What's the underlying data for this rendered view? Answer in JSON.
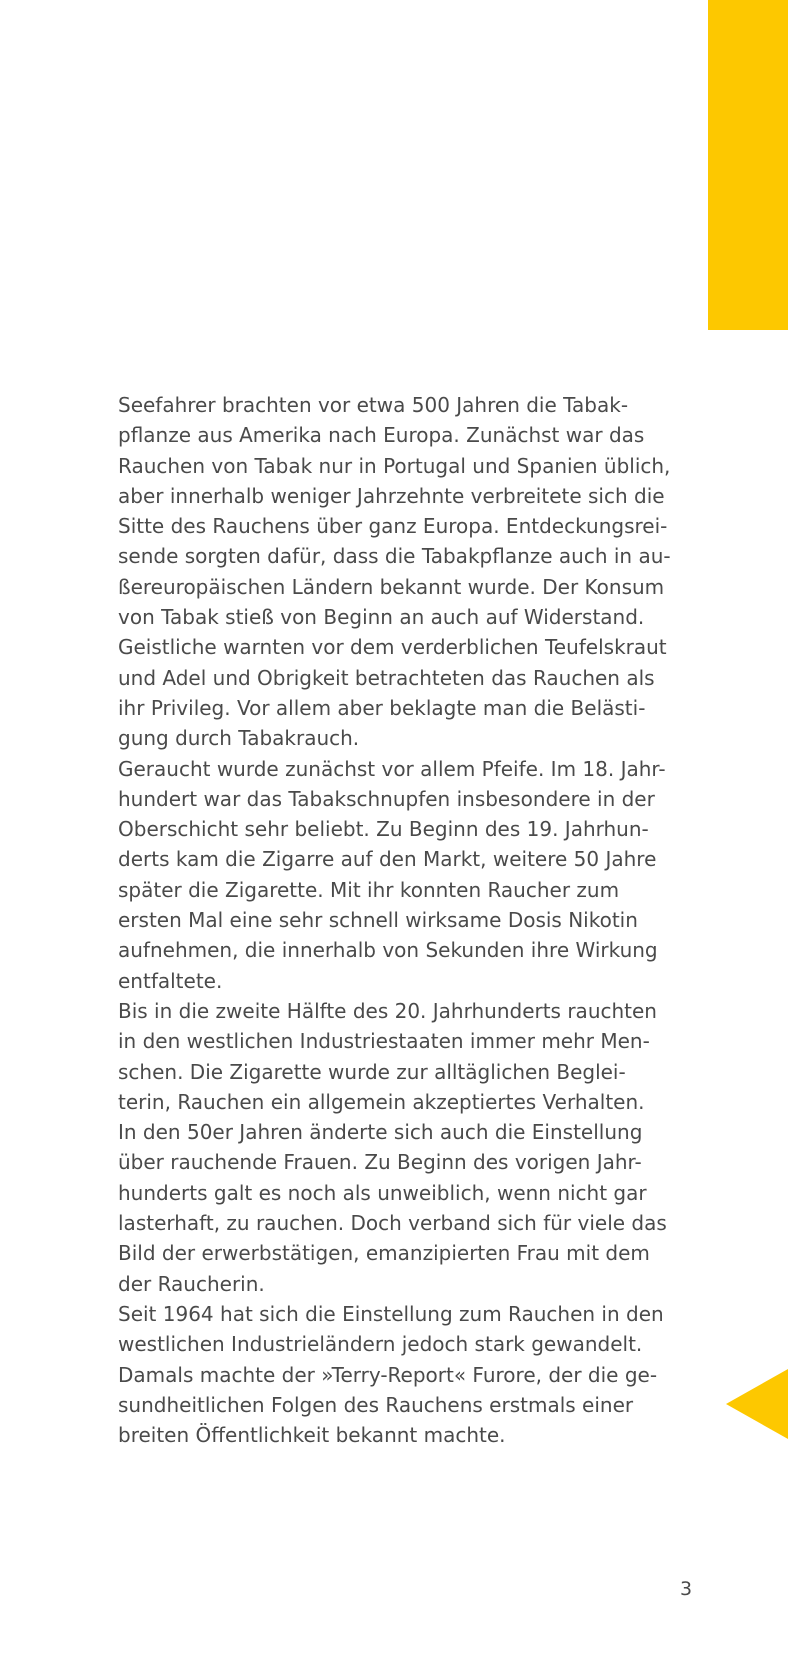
{
  "colors": {
    "accent": "#fdc800",
    "text": "#4a4a4a",
    "background": "#ffffff"
  },
  "article": {
    "lines": [
      "Seefahrer brachten vor etwa 500 Jahren die Tabak-",
      "pflanze aus Amerika nach Europa. Zunächst war das",
      "Rauchen von Tabak nur in Portugal und Spanien üblich,",
      "aber innerhalb weniger Jahrzehnte verbreitete sich die",
      "Sitte des Rauchens über ganz Europa. Entdeckungsrei-",
      "sende sorgten dafür, dass die Tabakpflanze auch in au-",
      "ßereuropäischen Ländern bekannt wurde. Der Konsum",
      "von Tabak stieß von Beginn an auch auf Widerstand.",
      "Geistliche warnten vor dem verderblichen Teufelskraut",
      "und Adel und Obrigkeit betrachteten das Rauchen als",
      "ihr Privileg. Vor allem aber beklagte man die Belästi-",
      "gung durch Tabakrauch.",
      "Geraucht wurde zunächst vor allem Pfeife. Im 18. Jahr-",
      "hundert war das Tabakschnupfen insbesondere in der",
      "Oberschicht sehr beliebt. Zu Beginn des 19. Jahrhun-",
      "derts kam die Zigarre auf den Markt, weitere 50 Jahre",
      "später die Zigarette. Mit ihr konnten Raucher zum",
      "ersten Mal eine sehr schnell wirksame Dosis Nikotin",
      "aufnehmen, die innerhalb von Sekunden ihre Wirkung",
      "entfaltete.",
      "Bis in die zweite Hälfte des 20. Jahrhunderts rauchten",
      "in den westlichen Industriestaaten immer mehr Men-",
      "schen. Die Zigarette wurde zur alltäglichen Beglei-",
      "terin, Rauchen ein allgemein akzeptiertes Verhalten.",
      "In den 50er Jahren änderte sich auch die Einstellung",
      "über rauchende Frauen. Zu Beginn des vorigen Jahr-",
      "hunderts galt es noch als unweiblich, wenn nicht gar",
      "lasterhaft, zu rauchen. Doch verband sich für viele das",
      "Bild der erwerbstätigen, emanzipierten Frau mit dem",
      "der Raucherin.",
      "Seit 1964 hat sich die Einstellung zum Rauchen in den",
      "westlichen Industrieländern jedoch stark gewandelt.",
      "Damals machte der »Terry-Report« Furore, der die ge-",
      "sundheitlichen Folgen des Rauchens erstmals einer",
      "breiten Öffentlichkeit bekannt machte."
    ]
  },
  "navigation": {
    "back_icon": "triangle-left-icon"
  },
  "footer": {
    "page_number": "3"
  }
}
